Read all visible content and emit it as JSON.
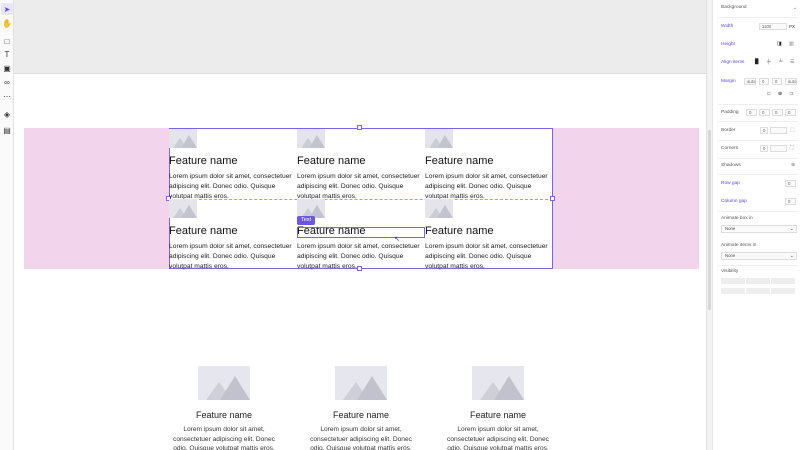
{
  "toolbar": {
    "tools": [
      {
        "name": "pointer-tool",
        "icon": "arrow-pointer-icon",
        "glyph": "➤"
      },
      {
        "name": "hand-tool",
        "icon": "hand-icon",
        "glyph": "✋"
      },
      {
        "name": "rectangle-tool",
        "icon": "square-icon",
        "glyph": "□"
      },
      {
        "name": "text-tool",
        "icon": "text-icon",
        "glyph": "T"
      },
      {
        "name": "image-tool",
        "icon": "image-icon",
        "glyph": "▣"
      },
      {
        "name": "component-tool",
        "icon": "link-icon",
        "glyph": "∞"
      },
      {
        "name": "more-tool",
        "icon": "more-icon",
        "glyph": "⋯"
      },
      {
        "name": "layers-tool",
        "icon": "layers-icon",
        "glyph": "◈"
      },
      {
        "name": "template-tool",
        "icon": "template-icon",
        "glyph": "▤"
      }
    ]
  },
  "canvas": {
    "grid_cells": [
      {
        "title": "Feature name",
        "body": "Lorem ipsum dolor sit amet, consectetuer adipiscing elit. Donec odio. Quisque volutpat mattis eros."
      },
      {
        "title": "Feature name",
        "body": "Lorem ipsum dolor sit amet, consectetuer adipiscing elit. Donec odio. Quisque volutpat mattis eros."
      },
      {
        "title": "Feature name",
        "body": "Lorem ipsum dolor sit amet, consectetuer adipiscing elit. Donec odio. Quisque volutpat mattis eros."
      },
      {
        "title": "Feature name",
        "body": "Lorem ipsum dolor sit amet, consectetuer adipiscing elit. Donec odio. Quisque volutpat mattis eros."
      },
      {
        "title": "Feature name",
        "body": "Lorem ipsum dolor sit amet, consectetuer adipiscing elit. Donec odio. Quisque volutpat mattis eros."
      },
      {
        "title": "Feature name",
        "body": "Lorem ipsum dolor sit amet, consectetuer adipiscing elit. Donec odio. Quisque volutpat mattis eros."
      }
    ],
    "selection_tag": "Text",
    "lower_cards": [
      {
        "title": "Feature name",
        "body": "Lorem ipsum dolor sit amet, consectetuer adipiscing elit. Donec odio. Quisque volutpat mattis eros."
      },
      {
        "title": "Feature name",
        "body": "Lorem ipsum dolor sit amet, consectetuer adipiscing elit. Donec odio. Quisque volutpat mattis eros."
      },
      {
        "title": "Feature name",
        "body": "Lorem ipsum dolor sit amet, consectetuer adipiscing elit. Donec odio. Quisque volutpat mattis eros."
      }
    ]
  },
  "panel": {
    "background_label": "Background",
    "width_label": "Width",
    "width_value": "1100",
    "width_unit": "PX",
    "height_label": "Height",
    "align_items_label": "Align items",
    "margin_label": "Margin",
    "margin_left": "auto",
    "margin_top": "0",
    "margin_bottom": "0",
    "margin_right": "auto",
    "padding_label": "Padding",
    "padding_values": [
      "0",
      "0",
      "0",
      "0"
    ],
    "border_label": "Border",
    "border_value": "0",
    "corners_label": "Corners",
    "corners_value": "0",
    "shadows_label": "Shadows",
    "row_gap_label": "Row gap",
    "row_gap_value": "0",
    "column_gap_label": "Column gap",
    "column_gap_value": "0",
    "animate_box_label": "Animate box in",
    "animate_box_value": "None",
    "animate_items_label": "Animate items in",
    "animate_items_value": "None",
    "visibility_label": "Visibility"
  }
}
